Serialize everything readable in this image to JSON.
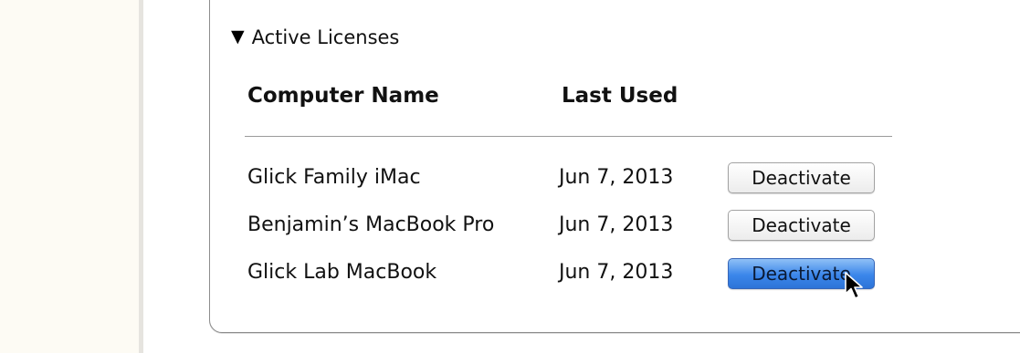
{
  "section": {
    "toggle_glyph": "▼",
    "title": "Active Licenses"
  },
  "table": {
    "columns": [
      "Computer Name",
      "Last Used"
    ],
    "rows": [
      {
        "computer_name": "Glick Family iMac",
        "last_used": "Jun 7, 2013",
        "action": "Deactivate"
      },
      {
        "computer_name": "Benjamin’s MacBook Pro",
        "last_used": "Jun 7, 2013",
        "action": "Deactivate"
      },
      {
        "computer_name": "Glick Lab MacBook",
        "last_used": "Jun 7, 2013",
        "action": "Deactivate"
      }
    ]
  },
  "icons": {
    "cursor": "arrow-pointer-icon",
    "disclosure": "disclosure-triangle-down-icon"
  },
  "colors": {
    "button_active_blue": "#3b86ea",
    "rule_gray": "#9a9a9a"
  }
}
